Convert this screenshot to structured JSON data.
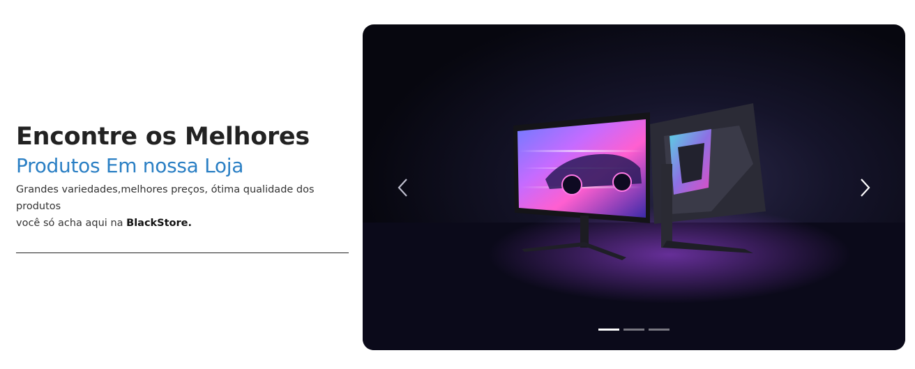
{
  "hero": {
    "headline": "Encontre os Melhores",
    "subheadline": "Produtos Em nossa Loja",
    "description_line1": "Grandes variedades,melhores preços, ótima qualidade dos produtos",
    "description_line2_prefix": "você só acha aqui na ",
    "brand": "BlackStore."
  },
  "carousel": {
    "prev_icon": "chevron-left-icon",
    "next_icon": "chevron-right-icon",
    "slide_image": "gaming-monitors-image",
    "indicators": [
      {
        "active": true
      },
      {
        "active": false
      },
      {
        "active": false
      }
    ]
  },
  "colors": {
    "headline": "#222222",
    "subheadline": "#2a7fc4",
    "indicator_active": "#ffffff",
    "indicator_inactive": "rgba(255,255,255,0.45)"
  }
}
